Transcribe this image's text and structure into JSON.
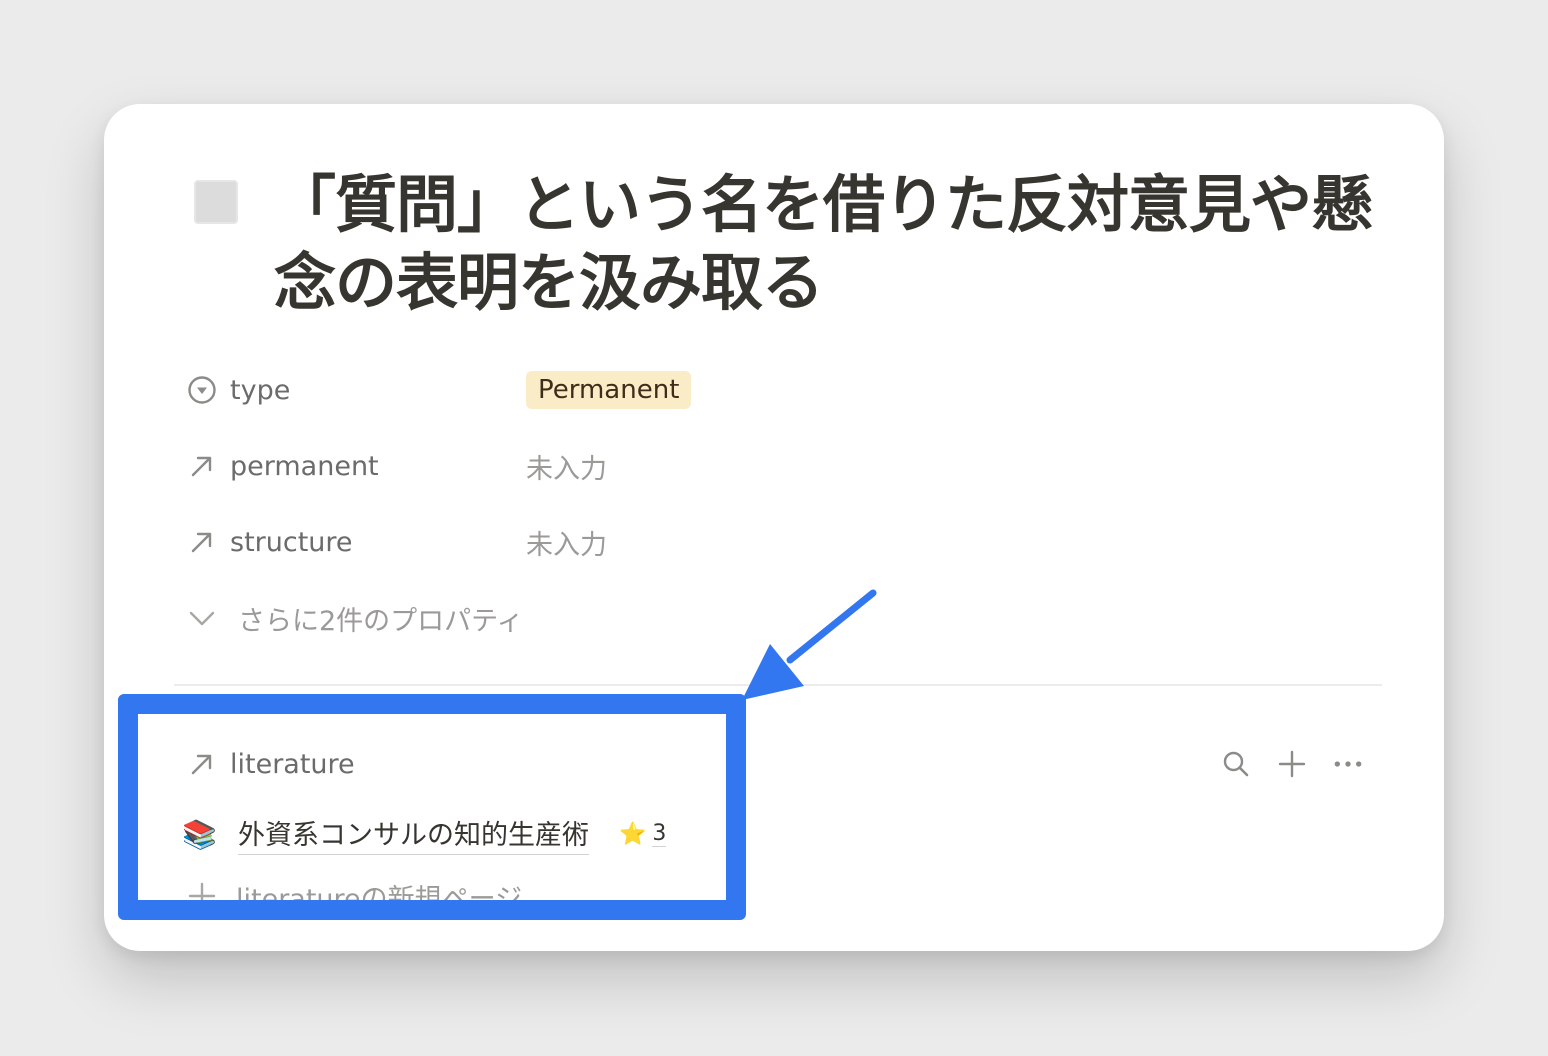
{
  "page": {
    "title": "「質問」という名を借りた反対意見や懸念の表明を汲み取る",
    "icon": "page-placeholder-icon"
  },
  "properties": [
    {
      "icon": "select-icon",
      "name": "type",
      "value": "Permanent",
      "value_style": "pill",
      "pill_color": "#fbecc8"
    },
    {
      "icon": "relation-arrow-icon",
      "name": "permanent",
      "value": "未入力",
      "value_style": "empty"
    },
    {
      "icon": "relation-arrow-icon",
      "name": "structure",
      "value": "未入力",
      "value_style": "empty"
    }
  ],
  "more_properties": {
    "icon": "chevron-down-icon",
    "label": "さらに2件のプロパティ"
  },
  "relation": {
    "icon": "relation-arrow-icon",
    "label": "literature",
    "actions": [
      "search-icon",
      "plus-icon",
      "more-icon"
    ],
    "items": [
      {
        "icon": "books-emoji",
        "emoji": "📚",
        "title": "外資系コンサルの知的生産術",
        "rating_icon": "⭐",
        "rating": "3"
      }
    ],
    "new_page_label": "literatureの新規ページ"
  },
  "annotation": {
    "highlight_color": "#3277f0"
  }
}
